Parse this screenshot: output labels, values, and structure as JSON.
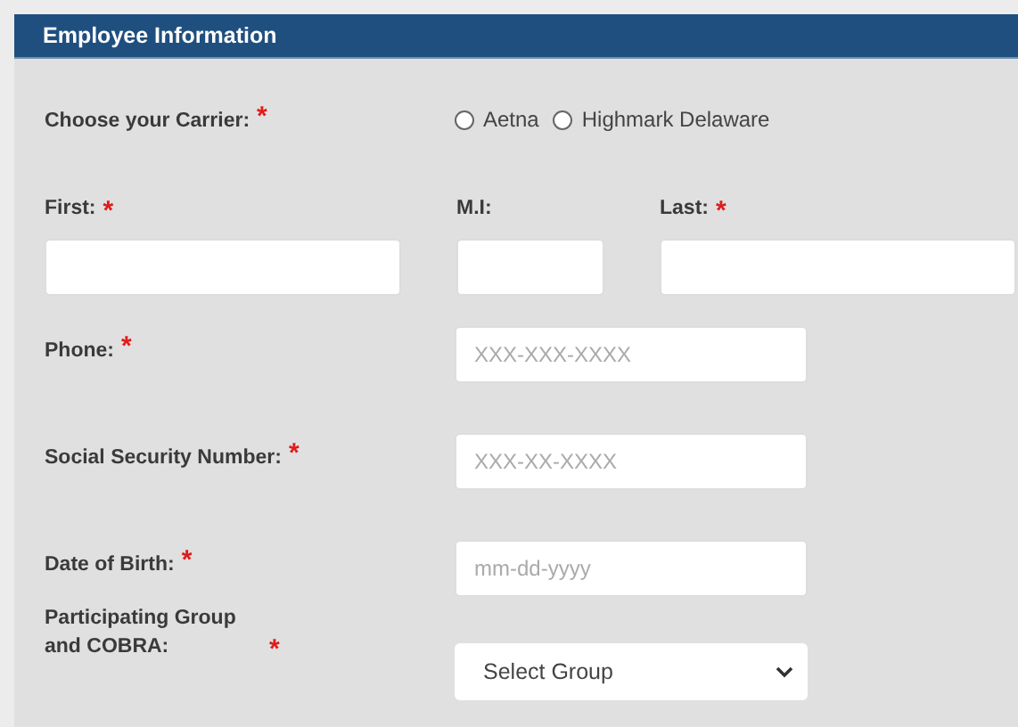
{
  "section_title": "Employee Information",
  "carrier": {
    "label": "Choose your Carrier:",
    "mark": "*",
    "options": [
      {
        "label": "Aetna",
        "selected": false
      },
      {
        "label": "Highmark Delaware",
        "selected": false
      }
    ]
  },
  "name_fields": [
    {
      "label": "First:",
      "mark": "*"
    },
    {
      "label": "M.I:"
    },
    {
      "label": "Last:",
      "mark": "*"
    }
  ],
  "fields": [
    {
      "kind": "text",
      "label": "Phone:",
      "mark": "*",
      "placeholder": "XXX-XXX-XXXX"
    },
    {
      "kind": "text",
      "label": "Social Security Number:",
      "mark": "*",
      "placeholder": "XXX-XX-XXXX"
    },
    {
      "kind": "text",
      "label": "Date of Birth:",
      "mark": "*",
      "placeholder": "mm-dd-yyyy"
    },
    {
      "kind": "select",
      "label": "Participating Group and COBRA:",
      "mark": "*",
      "value": "Select Group"
    }
  ]
}
